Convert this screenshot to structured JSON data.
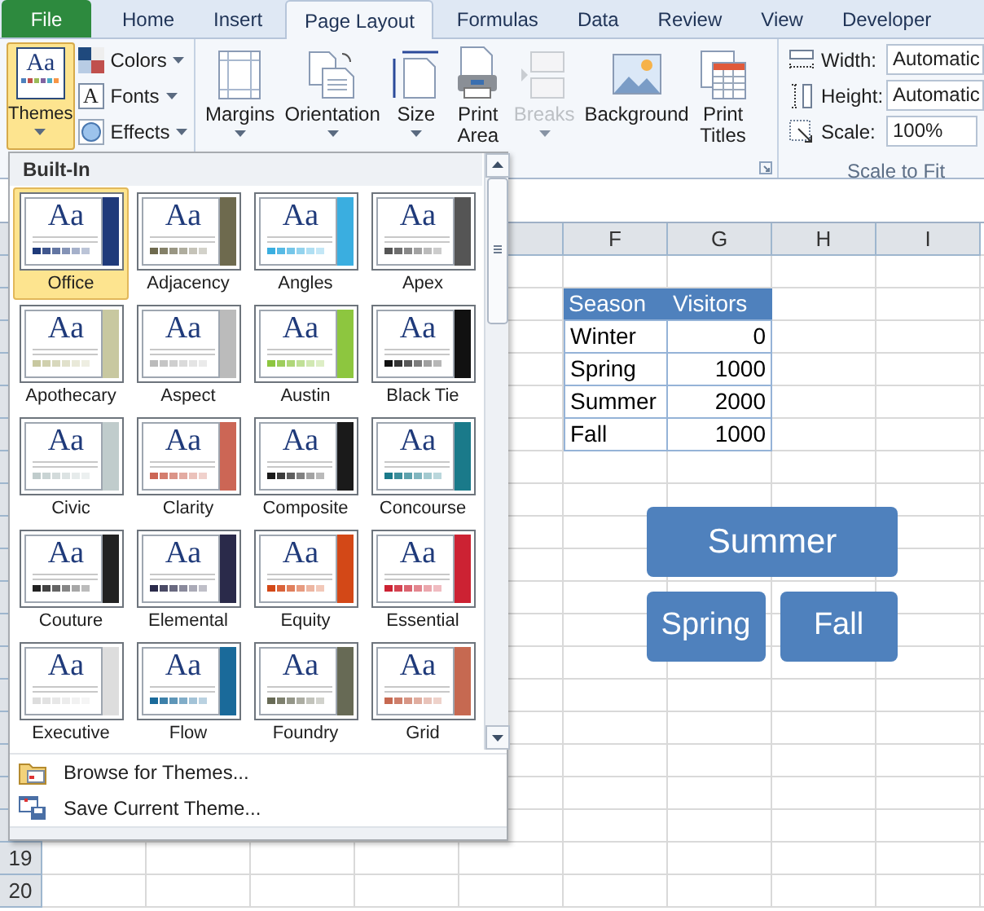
{
  "tabs": [
    {
      "label": "File",
      "kind": "file",
      "selected": false
    },
    {
      "label": "Home",
      "kind": "tab",
      "selected": false
    },
    {
      "label": "Insert",
      "kind": "tab",
      "selected": false
    },
    {
      "label": "Page Layout",
      "kind": "tab",
      "selected": true
    },
    {
      "label": "Formulas",
      "kind": "tab",
      "selected": false
    },
    {
      "label": "Data",
      "kind": "tab",
      "selected": false
    },
    {
      "label": "Review",
      "kind": "tab",
      "selected": false
    },
    {
      "label": "View",
      "kind": "tab",
      "selected": false
    },
    {
      "label": "Developer",
      "kind": "tab",
      "selected": false
    }
  ],
  "themes_group": {
    "themes_button": {
      "label": "Themes",
      "icon_text": "Aa",
      "pressed": true
    },
    "items": [
      {
        "label": "Colors",
        "kind": "colors"
      },
      {
        "label": "Fonts",
        "kind": "fonts",
        "icon_text": "A"
      },
      {
        "label": "Effects",
        "kind": "effects"
      }
    ]
  },
  "page_setup_group": {
    "buttons": [
      {
        "lines": [
          "Margins"
        ],
        "kind": "margins",
        "disabled": false
      },
      {
        "lines": [
          "Orientation"
        ],
        "kind": "orientation",
        "disabled": false
      },
      {
        "lines": [
          "Size"
        ],
        "kind": "size",
        "disabled": false
      },
      {
        "lines": [
          "Print",
          "Area"
        ],
        "kind": "print_area",
        "disabled": false
      },
      {
        "lines": [
          "Breaks"
        ],
        "kind": "breaks",
        "disabled": true
      },
      {
        "lines": [
          "Background"
        ],
        "kind": "background",
        "disabled": false
      },
      {
        "lines": [
          "Print",
          "Titles"
        ],
        "kind": "print_titles",
        "disabled": false
      }
    ]
  },
  "scale_group": {
    "title": "Scale to Fit",
    "fields": [
      {
        "kind": "width",
        "label": "Width:",
        "value": "Automatic"
      },
      {
        "kind": "height",
        "label": "Height:",
        "value": "Automatic"
      },
      {
        "kind": "scale",
        "label": "Scale:",
        "value": "100%"
      }
    ]
  },
  "themes_dropdown": {
    "header": "Built-In",
    "themes": [
      {
        "name": "Office",
        "sample": "Aa",
        "selected": true,
        "color": "#1f3a7a"
      },
      {
        "name": "Adjacency",
        "sample": "Aa",
        "selected": false,
        "color": "#6e6a4e"
      },
      {
        "name": "Angles",
        "sample": "Aa",
        "selected": false,
        "color": "#3aaee0"
      },
      {
        "name": "Apex",
        "sample": "Aa",
        "selected": false,
        "color": "#555555"
      },
      {
        "name": "Apothecary",
        "sample": "Aa",
        "selected": false,
        "color": "#c8c8a0"
      },
      {
        "name": "Aspect",
        "sample": "Aa",
        "selected": false,
        "color": "#bbbbbb"
      },
      {
        "name": "Austin",
        "sample": "Aa",
        "selected": false,
        "color": "#8dc63f"
      },
      {
        "name": "Black Tie",
        "sample": "Aa",
        "selected": false,
        "color": "#111111"
      },
      {
        "name": "Civic",
        "sample": "Aa",
        "selected": false,
        "color": "#c0cccc"
      },
      {
        "name": "Clarity",
        "sample": "Aa",
        "selected": false,
        "color": "#cc6655"
      },
      {
        "name": "Composite",
        "sample": "Aa",
        "selected": false,
        "color": "#1a1a1a"
      },
      {
        "name": "Concourse",
        "sample": "Aa",
        "selected": false,
        "color": "#1a7a8a"
      },
      {
        "name": "Couture",
        "sample": "Aa",
        "selected": false,
        "color": "#222222"
      },
      {
        "name": "Elemental",
        "sample": "Aa",
        "selected": false,
        "color": "#2a2a4a"
      },
      {
        "name": "Equity",
        "sample": "Aa",
        "selected": false,
        "color": "#d34817"
      },
      {
        "name": "Essential",
        "sample": "Aa",
        "selected": false,
        "color": "#cc2233"
      },
      {
        "name": "Executive",
        "sample": "Aa",
        "selected": false,
        "color": "#dddddd"
      },
      {
        "name": "Flow",
        "sample": "Aa",
        "selected": false,
        "color": "#1a6a9a"
      },
      {
        "name": "Foundry",
        "sample": "Aa",
        "selected": false,
        "color": "#676a55"
      },
      {
        "name": "Grid",
        "sample": "Aa",
        "selected": false,
        "color": "#c66951"
      }
    ],
    "menu_items": [
      {
        "label": "Browse for Themes...",
        "kind": "browse"
      },
      {
        "label": "Save Current Theme...",
        "kind": "save"
      }
    ]
  },
  "sheet": {
    "columns": [
      "F",
      "G",
      "H",
      "I"
    ],
    "row_numbers": [
      "19",
      "20"
    ],
    "table": {
      "header": [
        "Season",
        "Visitors"
      ],
      "rows": [
        [
          "Winter",
          "0"
        ],
        [
          "Spring",
          "1000"
        ],
        [
          "Summer",
          "2000"
        ],
        [
          "Fall",
          "1000"
        ]
      ]
    },
    "smartart": [
      {
        "label": "Summer",
        "kind": "top"
      },
      {
        "label": "Spring",
        "kind": "child"
      },
      {
        "label": "Fall",
        "kind": "child"
      }
    ]
  }
}
